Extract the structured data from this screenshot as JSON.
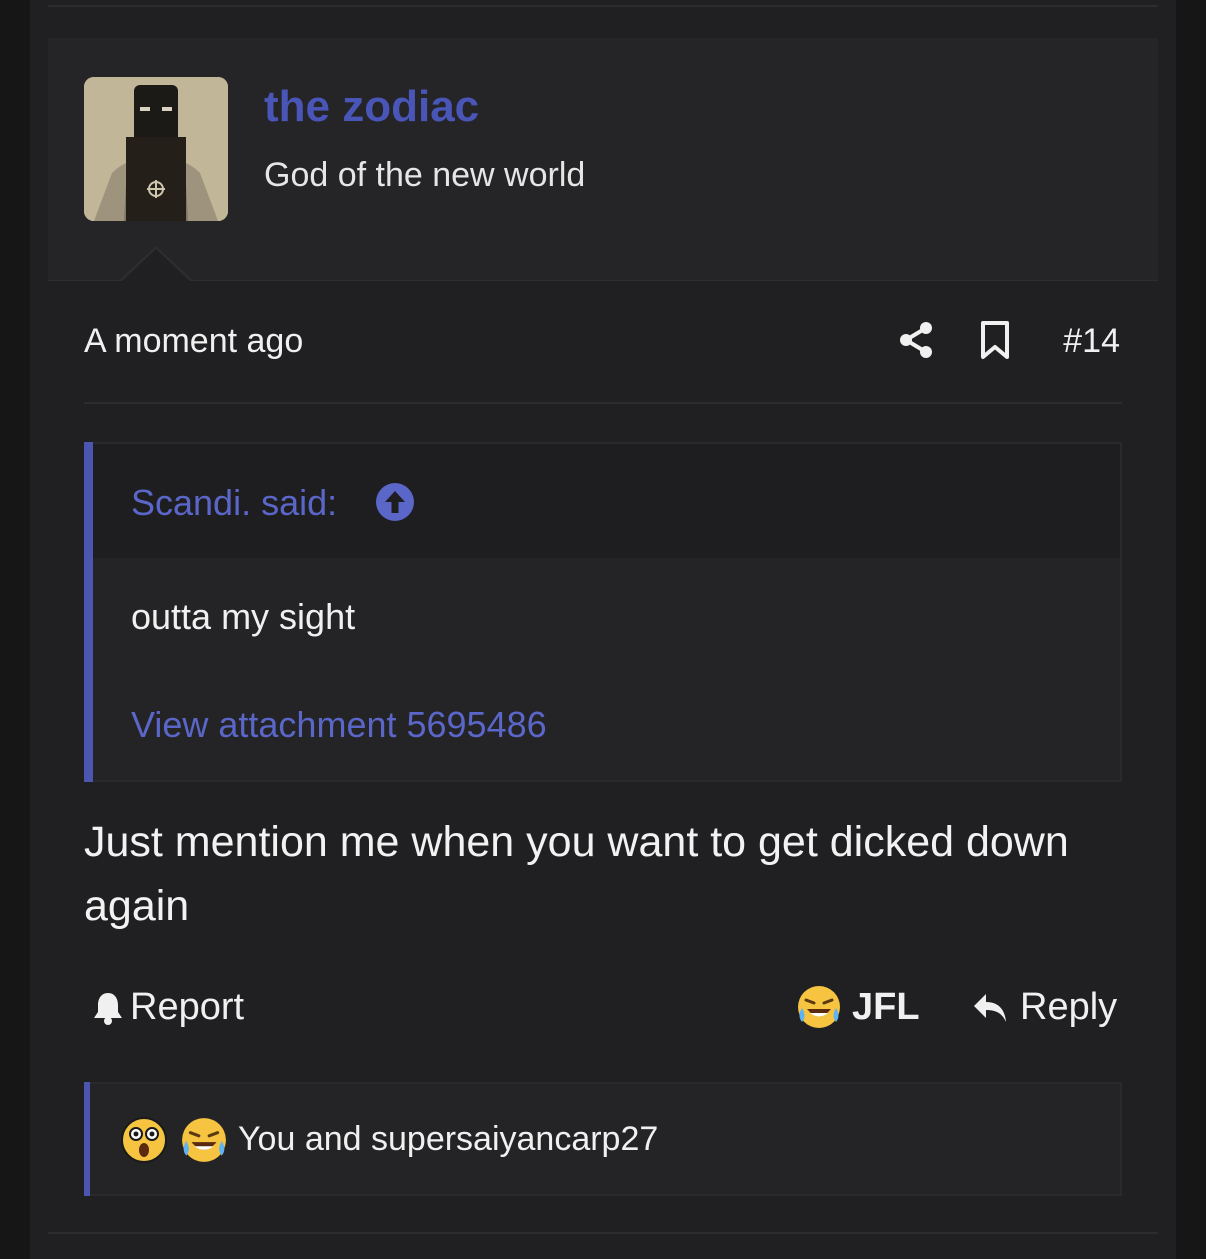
{
  "post": {
    "author": {
      "name": "the zodiac",
      "title": "God of the new world"
    },
    "timestamp": "A moment ago",
    "number": "#14",
    "quote": {
      "author": "Scandi. said:",
      "text": "outta my sight",
      "attachment": "View attachment 5695486"
    },
    "body": "Just mention me when you want to get dicked down again",
    "actions": {
      "report": "Report",
      "reaction": "JFL",
      "reply": "Reply"
    },
    "reactions_summary": "You and supersaiyancarp27"
  },
  "icons": {
    "share": "share-icon",
    "bookmark": "bookmark-icon",
    "jump": "arrow-up-circle-icon",
    "report": "bell-icon",
    "reply": "reply-arrow-icon"
  },
  "colors": {
    "accent": "#4a55b8",
    "link": "#5a66c8",
    "background": "#202022"
  }
}
